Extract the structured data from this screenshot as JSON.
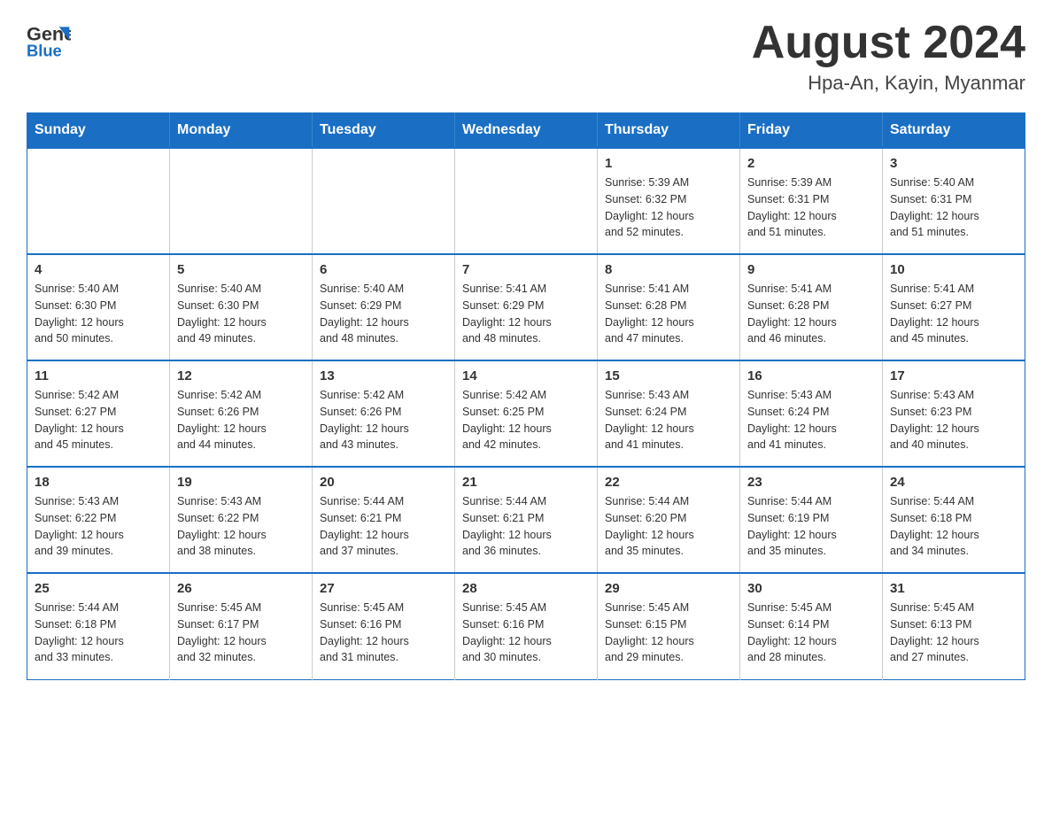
{
  "header": {
    "logo_general": "General",
    "logo_blue": "Blue",
    "month_title": "August 2024",
    "location": "Hpa-An, Kayin, Myanmar"
  },
  "weekdays": [
    "Sunday",
    "Monday",
    "Tuesday",
    "Wednesday",
    "Thursday",
    "Friday",
    "Saturday"
  ],
  "weeks": [
    [
      {
        "day": "",
        "info": ""
      },
      {
        "day": "",
        "info": ""
      },
      {
        "day": "",
        "info": ""
      },
      {
        "day": "",
        "info": ""
      },
      {
        "day": "1",
        "info": "Sunrise: 5:39 AM\nSunset: 6:32 PM\nDaylight: 12 hours\nand 52 minutes."
      },
      {
        "day": "2",
        "info": "Sunrise: 5:39 AM\nSunset: 6:31 PM\nDaylight: 12 hours\nand 51 minutes."
      },
      {
        "day": "3",
        "info": "Sunrise: 5:40 AM\nSunset: 6:31 PM\nDaylight: 12 hours\nand 51 minutes."
      }
    ],
    [
      {
        "day": "4",
        "info": "Sunrise: 5:40 AM\nSunset: 6:30 PM\nDaylight: 12 hours\nand 50 minutes."
      },
      {
        "day": "5",
        "info": "Sunrise: 5:40 AM\nSunset: 6:30 PM\nDaylight: 12 hours\nand 49 minutes."
      },
      {
        "day": "6",
        "info": "Sunrise: 5:40 AM\nSunset: 6:29 PM\nDaylight: 12 hours\nand 48 minutes."
      },
      {
        "day": "7",
        "info": "Sunrise: 5:41 AM\nSunset: 6:29 PM\nDaylight: 12 hours\nand 48 minutes."
      },
      {
        "day": "8",
        "info": "Sunrise: 5:41 AM\nSunset: 6:28 PM\nDaylight: 12 hours\nand 47 minutes."
      },
      {
        "day": "9",
        "info": "Sunrise: 5:41 AM\nSunset: 6:28 PM\nDaylight: 12 hours\nand 46 minutes."
      },
      {
        "day": "10",
        "info": "Sunrise: 5:41 AM\nSunset: 6:27 PM\nDaylight: 12 hours\nand 45 minutes."
      }
    ],
    [
      {
        "day": "11",
        "info": "Sunrise: 5:42 AM\nSunset: 6:27 PM\nDaylight: 12 hours\nand 45 minutes."
      },
      {
        "day": "12",
        "info": "Sunrise: 5:42 AM\nSunset: 6:26 PM\nDaylight: 12 hours\nand 44 minutes."
      },
      {
        "day": "13",
        "info": "Sunrise: 5:42 AM\nSunset: 6:26 PM\nDaylight: 12 hours\nand 43 minutes."
      },
      {
        "day": "14",
        "info": "Sunrise: 5:42 AM\nSunset: 6:25 PM\nDaylight: 12 hours\nand 42 minutes."
      },
      {
        "day": "15",
        "info": "Sunrise: 5:43 AM\nSunset: 6:24 PM\nDaylight: 12 hours\nand 41 minutes."
      },
      {
        "day": "16",
        "info": "Sunrise: 5:43 AM\nSunset: 6:24 PM\nDaylight: 12 hours\nand 41 minutes."
      },
      {
        "day": "17",
        "info": "Sunrise: 5:43 AM\nSunset: 6:23 PM\nDaylight: 12 hours\nand 40 minutes."
      }
    ],
    [
      {
        "day": "18",
        "info": "Sunrise: 5:43 AM\nSunset: 6:22 PM\nDaylight: 12 hours\nand 39 minutes."
      },
      {
        "day": "19",
        "info": "Sunrise: 5:43 AM\nSunset: 6:22 PM\nDaylight: 12 hours\nand 38 minutes."
      },
      {
        "day": "20",
        "info": "Sunrise: 5:44 AM\nSunset: 6:21 PM\nDaylight: 12 hours\nand 37 minutes."
      },
      {
        "day": "21",
        "info": "Sunrise: 5:44 AM\nSunset: 6:21 PM\nDaylight: 12 hours\nand 36 minutes."
      },
      {
        "day": "22",
        "info": "Sunrise: 5:44 AM\nSunset: 6:20 PM\nDaylight: 12 hours\nand 35 minutes."
      },
      {
        "day": "23",
        "info": "Sunrise: 5:44 AM\nSunset: 6:19 PM\nDaylight: 12 hours\nand 35 minutes."
      },
      {
        "day": "24",
        "info": "Sunrise: 5:44 AM\nSunset: 6:18 PM\nDaylight: 12 hours\nand 34 minutes."
      }
    ],
    [
      {
        "day": "25",
        "info": "Sunrise: 5:44 AM\nSunset: 6:18 PM\nDaylight: 12 hours\nand 33 minutes."
      },
      {
        "day": "26",
        "info": "Sunrise: 5:45 AM\nSunset: 6:17 PM\nDaylight: 12 hours\nand 32 minutes."
      },
      {
        "day": "27",
        "info": "Sunrise: 5:45 AM\nSunset: 6:16 PM\nDaylight: 12 hours\nand 31 minutes."
      },
      {
        "day": "28",
        "info": "Sunrise: 5:45 AM\nSunset: 6:16 PM\nDaylight: 12 hours\nand 30 minutes."
      },
      {
        "day": "29",
        "info": "Sunrise: 5:45 AM\nSunset: 6:15 PM\nDaylight: 12 hours\nand 29 minutes."
      },
      {
        "day": "30",
        "info": "Sunrise: 5:45 AM\nSunset: 6:14 PM\nDaylight: 12 hours\nand 28 minutes."
      },
      {
        "day": "31",
        "info": "Sunrise: 5:45 AM\nSunset: 6:13 PM\nDaylight: 12 hours\nand 27 minutes."
      }
    ]
  ]
}
